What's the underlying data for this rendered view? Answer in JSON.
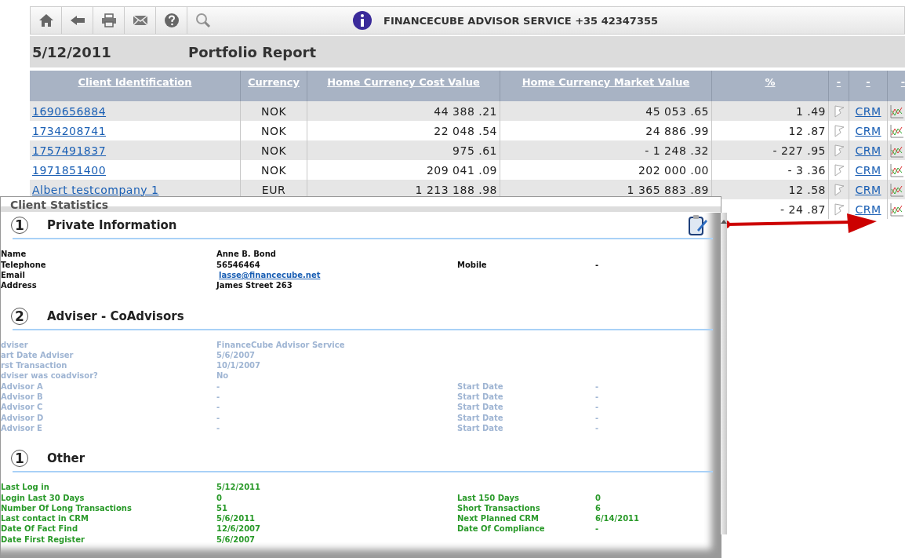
{
  "toolbar": {
    "title": "FINANCECUBE ADVISOR SERVICE +35 42347355"
  },
  "report": {
    "date": "5/12/2011",
    "title": "Portfolio Report"
  },
  "table": {
    "columns": [
      "Client Identification",
      "Currency",
      "Home Currency Cost Value",
      "Home Currency Market Value",
      "%",
      "-",
      "-",
      "-"
    ],
    "rows": [
      {
        "client": "1690656884",
        "currency": "NOK",
        "cost": "44 388 .21",
        "market": "45 053 .65",
        "percent": "1 .49",
        "link": "CRM"
      },
      {
        "client": "1734208741",
        "currency": "NOK",
        "cost": "22 048 .54",
        "market": "24 886 .99",
        "percent": "12 .87",
        "link": "CRM"
      },
      {
        "client": "1757491837",
        "currency": "NOK",
        "cost": "975 .61",
        "market": "- 1 248 .32",
        "percent": "- 227 .95",
        "link": "CRM"
      },
      {
        "client": "1971851400",
        "currency": "NOK",
        "cost": "209 041 .09",
        "market": "202 000 .00",
        "percent": "- 3 .36",
        "link": "CRM"
      },
      {
        "client": "Albert testcompany 1",
        "currency": "EUR",
        "cost": "1 213 188 .98",
        "market": "1 365 883 .89",
        "percent": "12 .58",
        "link": "CRM"
      },
      {
        "percent": "- 24 .87",
        "link": "CRM"
      }
    ]
  },
  "popup": {
    "title": "Client Statistics",
    "sections": [
      {
        "number": "1",
        "title": "Private Information",
        "kind": "private",
        "rows": [
          {
            "label": "Name",
            "value": "Anne B. Bond"
          },
          {
            "label": "Telephone",
            "value": "56546464",
            "label2": "Mobile",
            "value2": "-"
          },
          {
            "label": "Email",
            "value": "lasse@financecube.net",
            "link": true
          },
          {
            "label": "Address",
            "value": "James Street 263"
          }
        ]
      },
      {
        "number": "2",
        "title": "Adviser - CoAdvisors",
        "kind": "adviser",
        "rows": [
          {
            "label": "dviser",
            "value": "FinanceCube Advisor Service"
          },
          {
            "label": "art Date Adviser",
            "value": "5/6/2007"
          },
          {
            "label": "rst Transaction",
            "value": "10/1/2007"
          },
          {
            "label": "dviser was coadvisor?",
            "value": "No"
          },
          {
            "label": "Advisor A",
            "value": "-",
            "label2": "Start Date",
            "value2": "-"
          },
          {
            "label": "Advisor B",
            "value": "-",
            "label2": "Start Date",
            "value2": "-"
          },
          {
            "label": "Advisor C",
            "value": "-",
            "label2": "Start Date",
            "value2": "-"
          },
          {
            "label": "Advisor D",
            "value": "-",
            "label2": "Start Date",
            "value2": "-"
          },
          {
            "label": "Advisor E",
            "value": "-",
            "label2": "Start Date",
            "value2": "-"
          }
        ]
      },
      {
        "number": "1",
        "title": "Other",
        "kind": "other",
        "rows": [
          {
            "label": "Last Log in",
            "value": "5/12/2011"
          },
          {
            "label": "Login Last 30 Days",
            "value": "0",
            "label2": "Last 150 Days",
            "value2": "0"
          },
          {
            "label": "Number Of Long Transactions",
            "value": "51",
            "label2": "Short Transactions",
            "value2": "6"
          },
          {
            "label": "Last contact in CRM",
            "value": "5/6/2011",
            "label2": "Next Planned CRM",
            "value2": "6/14/2011"
          },
          {
            "label": "Date Of Fact Find",
            "value": "12/6/2007",
            "label2": "Date Of Compliance",
            "value2": "-"
          },
          {
            "label": "Date First Register",
            "value": "5/6/2007"
          }
        ]
      }
    ]
  }
}
